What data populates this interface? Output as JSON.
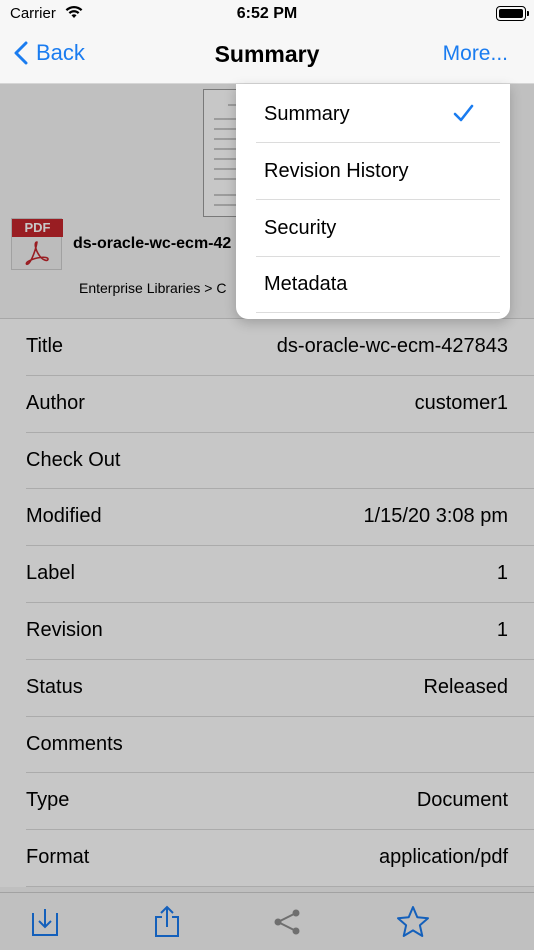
{
  "status": {
    "carrier": "Carrier",
    "time": "6:52 PM"
  },
  "nav": {
    "back_label": "Back",
    "title": "Summary",
    "more_label": "More..."
  },
  "document": {
    "file_type": "PDF",
    "name": "ds-oracle-wc-ecm-42",
    "path": "Enterprise Libraries > C"
  },
  "properties": [
    {
      "label": "Title",
      "value": "ds-oracle-wc-ecm-427843"
    },
    {
      "label": "Author",
      "value": "customer1"
    },
    {
      "label": "Check Out",
      "value": ""
    },
    {
      "label": "Modified",
      "value": "1/15/20 3:08 pm"
    },
    {
      "label": "Label",
      "value": "1"
    },
    {
      "label": "Revision",
      "value": "1"
    },
    {
      "label": "Status",
      "value": "Released"
    },
    {
      "label": "Comments",
      "value": ""
    },
    {
      "label": "Type",
      "value": "Document"
    },
    {
      "label": "Format",
      "value": "application/pdf"
    }
  ],
  "more_menu": {
    "items": [
      {
        "label": "Summary",
        "selected": true
      },
      {
        "label": "Revision History",
        "selected": false
      },
      {
        "label": "Security",
        "selected": false
      },
      {
        "label": "Metadata",
        "selected": false
      }
    ]
  },
  "toolbar": {
    "icons": [
      "download-icon",
      "share-upload-icon",
      "share-network-icon",
      "favorite-star-icon"
    ]
  },
  "colors": {
    "accent": "#1a7cf0",
    "pdf_red": "#c5262c"
  }
}
